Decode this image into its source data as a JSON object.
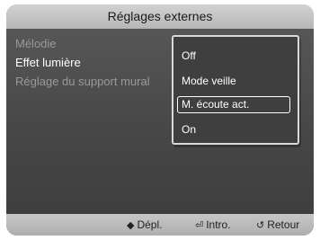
{
  "window": {
    "title": "Réglages externes"
  },
  "menu": {
    "items": [
      {
        "label": "Mélodie",
        "colon": ":"
      },
      {
        "label": "Effet lumière",
        "colon": ":"
      },
      {
        "label": "Réglage du support mural",
        "colon": ""
      }
    ]
  },
  "dropdown": {
    "options": [
      "Off",
      "Mode veille",
      "M. écoute act.",
      "On"
    ],
    "selected": "M. écoute act."
  },
  "footer": {
    "move_icon": "◆",
    "move_label": "Dépl.",
    "enter_icon": "⏎",
    "enter_label": "Intro.",
    "return_icon": "↺",
    "return_label": "Retour"
  }
}
